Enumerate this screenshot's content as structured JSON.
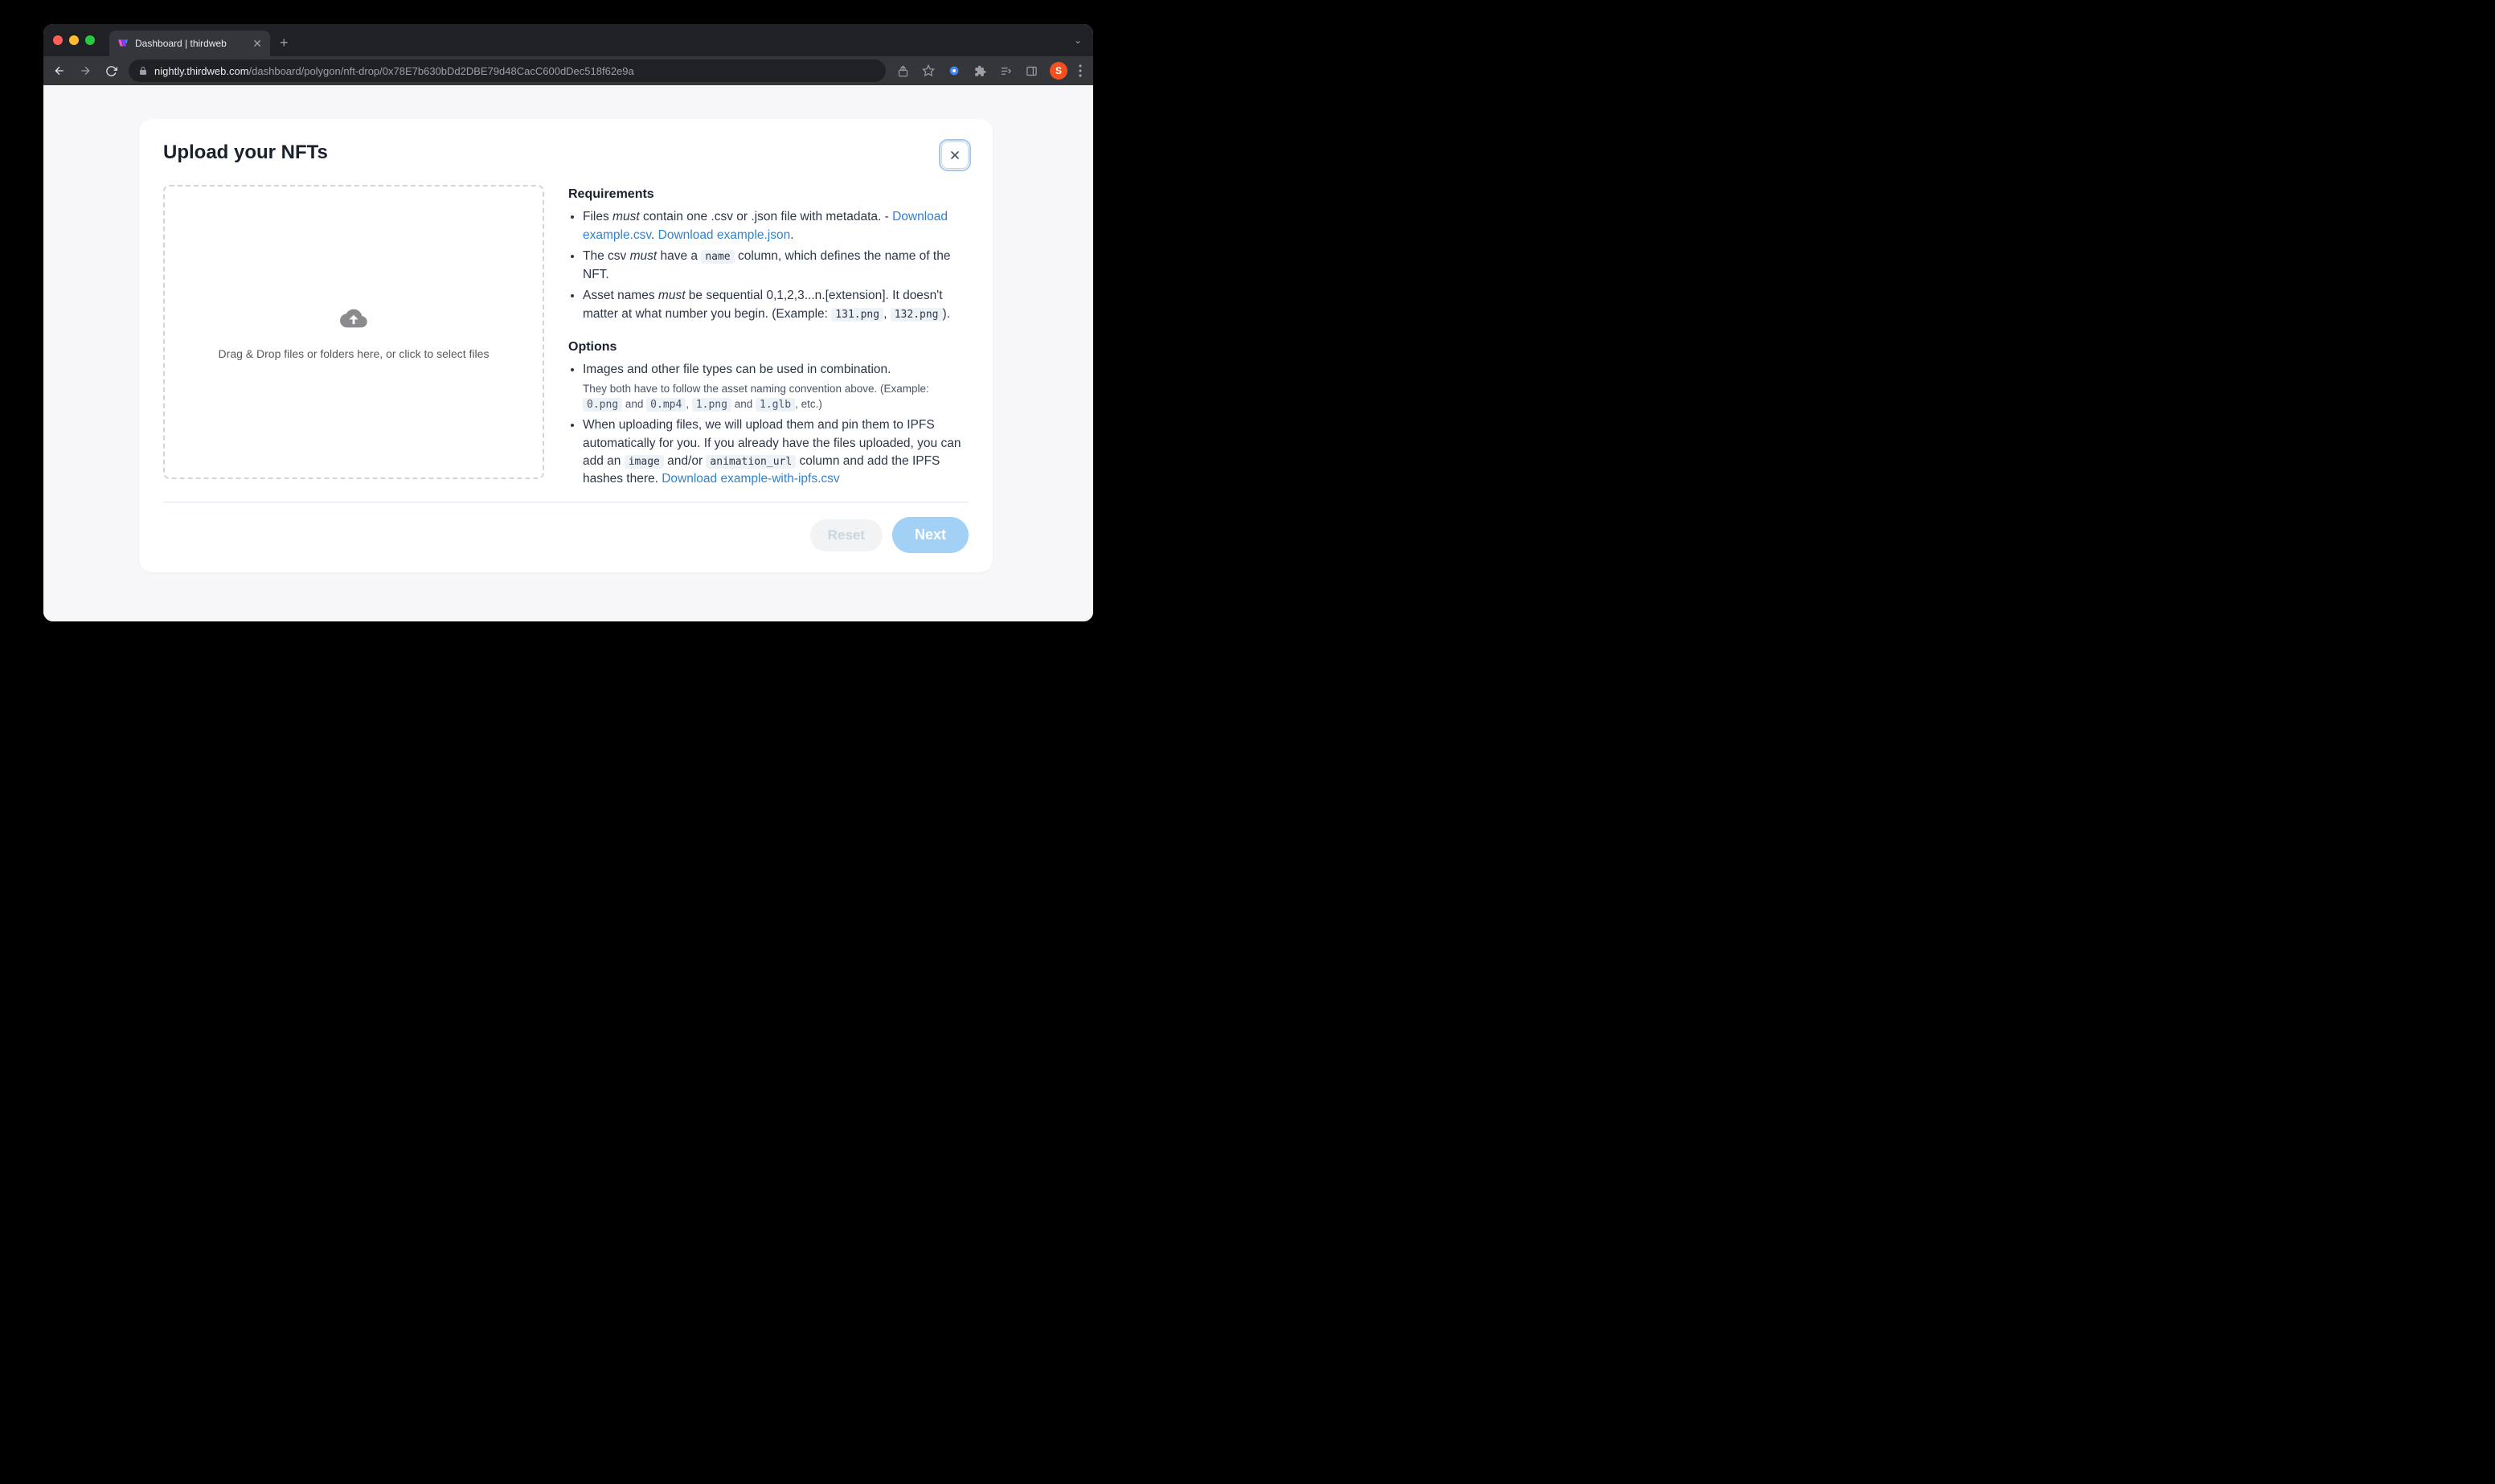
{
  "browser": {
    "tab_title": "Dashboard | thirdweb",
    "url_host": "nightly.thirdweb.com",
    "url_path": "/dashboard/polygon/nft-drop/0x78E7b630bDd2DBE79d48CacC600dDec518f62e9a",
    "avatar_letter": "S"
  },
  "modal": {
    "title": "Upload your NFTs",
    "dropzone_text": "Drag & Drop files or folders here, or click to select files",
    "requirements_heading": "Requirements",
    "req1_a": "Files ",
    "req1_must": "must",
    "req1_b": " contain one .csv or .json file with metadata. - ",
    "req1_link1": "Download example.csv",
    "req1_sep": ". ",
    "req1_link2": "Download example.json",
    "req1_end": ".",
    "req2_a": "The csv ",
    "req2_must": "must",
    "req2_b": " have a ",
    "req2_code": "name",
    "req2_c": " column, which defines the name of the NFT.",
    "req3_a": "Asset names ",
    "req3_must": "must",
    "req3_b": " be sequential 0,1,2,3...n.[extension]. It doesn't matter at what number you begin. (Example: ",
    "req3_code1": "131.png",
    "req3_sep": ", ",
    "req3_code2": "132.png",
    "req3_end": ").",
    "options_heading": "Options",
    "opt1_a": "Images and other file types can be used in combination.",
    "opt1_sub_a": "They both have to follow the asset naming convention above. (Example: ",
    "opt1_code1": "0.png",
    "opt1_sub_b": " and ",
    "opt1_code2": "0.mp4",
    "opt1_sub_c": ", ",
    "opt1_code3": "1.png",
    "opt1_sub_d": " and ",
    "opt1_code4": "1.glb",
    "opt1_sub_e": ", etc.)",
    "opt2_a": "When uploading files, we will upload them and pin them to IPFS automatically for you. If you already have the files uploaded, you can add an ",
    "opt2_code1": "image",
    "opt2_b": " and/or ",
    "opt2_code2": "animation_url",
    "opt2_c": " column and add the IPFS hashes there. ",
    "opt2_link": "Download example-with-ipfs.csv",
    "reset_label": "Reset",
    "next_label": "Next"
  }
}
